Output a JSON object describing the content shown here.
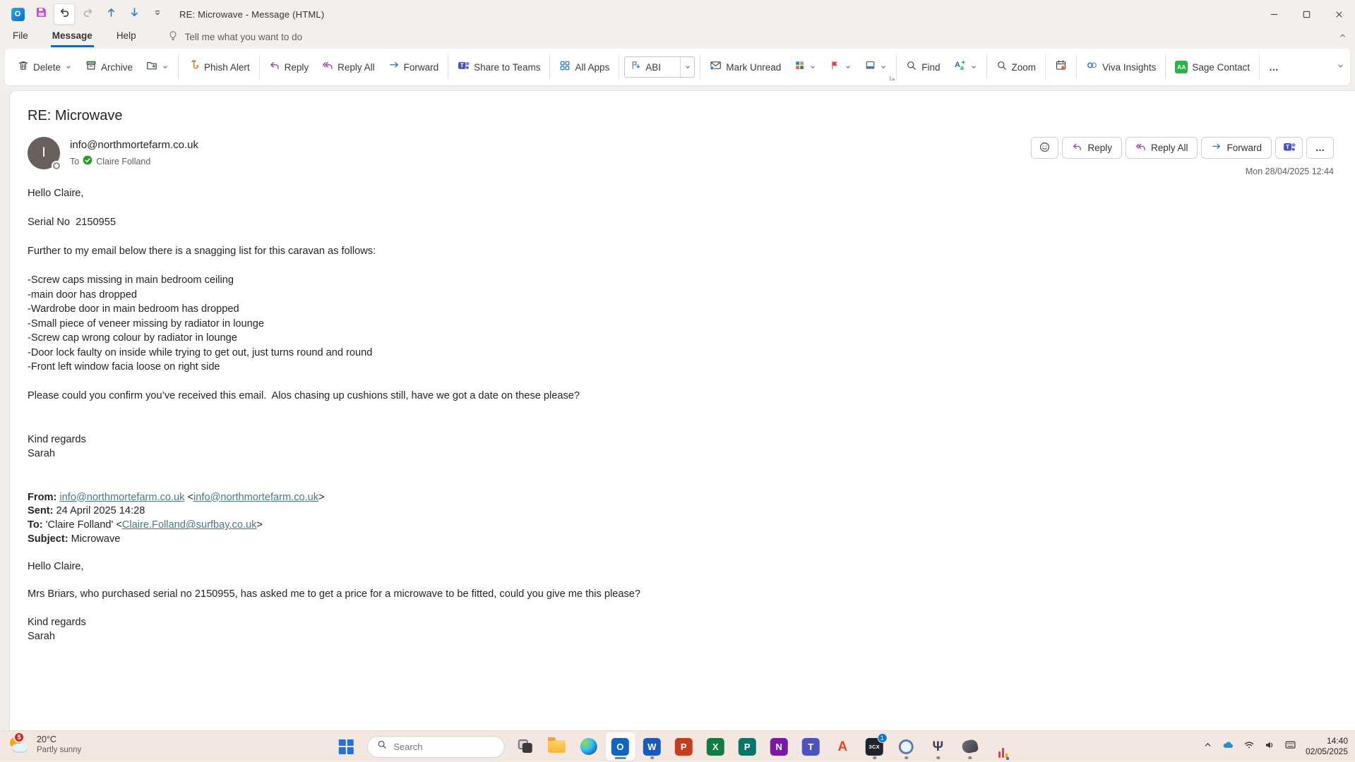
{
  "window": {
    "title": "RE: Microwave  -  Message (HTML)"
  },
  "qat": {
    "outlook_glyph": "O"
  },
  "menu": {
    "file": "File",
    "message": "Message",
    "help": "Help",
    "tellme": "Tell me what you want to do"
  },
  "ribbon": {
    "delete": "Delete",
    "archive": "Archive",
    "phish_alert": "Phish Alert",
    "reply": "Reply",
    "reply_all": "Reply All",
    "forward": "Forward",
    "share_to_teams": "Share to Teams",
    "all_apps": "All Apps",
    "quick_step": "ABI",
    "mark_unread": "Mark Unread",
    "find": "Find",
    "zoom": "Zoom",
    "viva_insights": "Viva Insights",
    "sage_contact": "Sage Contact",
    "sage_glyph": "AA",
    "more": "…"
  },
  "message": {
    "subject": "RE: Microwave",
    "avatar_initial": "I",
    "sender": "info@northmortefarm.co.uk",
    "to_label": "To",
    "recipient": "Claire Folland",
    "received": "Mon 28/04/2025 12:44",
    "actions": {
      "reply": "Reply",
      "reply_all": "Reply All",
      "forward": "Forward",
      "more": "…"
    },
    "body_lines": [
      "Hello Claire,",
      "",
      "Serial No  2150955",
      "",
      "Further to my email below there is a snagging list for this caravan as follows:",
      "",
      "-Screw caps missing in main bedroom ceiling",
      "-main door has dropped",
      "-Wardrobe door in main bedroom has dropped",
      "-Small piece of veneer missing by radiator in lounge",
      "-Screw cap wrong colour by radiator in lounge",
      "-Door lock faulty on inside while trying to get out, just turns round and round",
      "-Front left window facia loose on right side",
      "",
      "Please could you confirm you’ve received this email.  Alos chasing up cushions still, have we got a date on these please?",
      "",
      "",
      "Kind regards",
      "Sarah"
    ],
    "quoted_header": {
      "from_label": "From:",
      "from_link1": "info@northmortefarm.co.uk",
      "from_sep": " <",
      "from_link2": "info@northmortefarm.co.uk",
      "from_end": ">",
      "sent_label": "Sent:",
      "sent_value": " 24 April 2025 14:28",
      "to_label": "To:",
      "to_pre": " 'Claire Folland' <",
      "to_link": "Claire.Folland@surfbay.co.uk",
      "to_end": ">",
      "subject_label": "Subject:",
      "subject_value": " Microwave"
    },
    "quoted_body_lines": [
      "Hello Claire,",
      "",
      "Mrs Briars, who purchased serial no 2150955, has asked me to get a price for a microwave to be fitted, could you give me this please?",
      "",
      "Kind regards",
      "Sarah"
    ]
  },
  "taskbar": {
    "weather": {
      "badge": "5",
      "temp": "20°C",
      "condition": "Partly sunny"
    },
    "search_placeholder": "Search",
    "apps": [
      {
        "id": "task-view",
        "kind": "taskview"
      },
      {
        "id": "file-explorer",
        "kind": "folder"
      },
      {
        "id": "edge",
        "kind": "edge"
      },
      {
        "id": "outlook",
        "kind": "tile",
        "text": "O",
        "bg": "#1066bf",
        "active": true
      },
      {
        "id": "word",
        "kind": "tile",
        "text": "W",
        "bg": "#185abd",
        "running": true
      },
      {
        "id": "powerpoint",
        "kind": "tile",
        "text": "P",
        "bg": "#c43e1c"
      },
      {
        "id": "excel",
        "kind": "tile",
        "text": "X",
        "bg": "#107c41"
      },
      {
        "id": "publisher",
        "kind": "tile",
        "text": "P",
        "bg": "#077568"
      },
      {
        "id": "onenote",
        "kind": "tile",
        "text": "N",
        "bg": "#7719aa"
      },
      {
        "id": "teams",
        "kind": "tile",
        "text": "T",
        "bg": "#4b53bc"
      },
      {
        "id": "app-a",
        "kind": "letter",
        "text": "A",
        "color": "#e8442c"
      },
      {
        "id": "3cx",
        "kind": "tile",
        "text": "3CX",
        "bg": "#20232d",
        "small": true,
        "badge": "1",
        "running": true
      },
      {
        "id": "ring-app",
        "kind": "ring",
        "running": true
      },
      {
        "id": "person-app",
        "kind": "letter",
        "text": "Ψ",
        "color": "#3a3f52",
        "running": true
      },
      {
        "id": "dark-app",
        "kind": "blob",
        "running": true
      }
    ],
    "tray": {
      "time": "14:40",
      "date": "02/05/2025"
    }
  },
  "colors": {
    "accent": "#0f6cbd",
    "link": "#467886",
    "flag_red": "#e8403a",
    "sage_green": "#2d9a2d",
    "taskbar_bg": "#f4e7e1"
  }
}
